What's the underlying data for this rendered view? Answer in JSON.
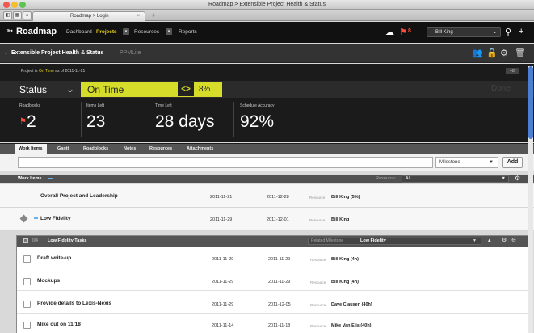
{
  "window": {
    "title": "Roadmap > Extensible Project Health & Status",
    "tab_title": "Roadmap > Login"
  },
  "navbar": {
    "brand": "Roadmap",
    "items": [
      {
        "label": "Dashboard"
      },
      {
        "label": "Projects"
      },
      {
        "label": "Resources"
      },
      {
        "label": "Reports"
      }
    ],
    "flag_count": "8",
    "user": "Bill King"
  },
  "project": {
    "title": "Extensible Project Health & Status",
    "subtitle": "PPMLite",
    "status_note_prefix": "Project is",
    "status_note_state": "On Time",
    "status_note_suffix": "as of 2011-11-21",
    "badge": "+8",
    "status_label": "Status",
    "status_value": "On Time",
    "percent": "8%",
    "done_label": "Done"
  },
  "metrics": [
    {
      "label": "Roadblocks",
      "value": "2"
    },
    {
      "label": "Items Left",
      "value": "23"
    },
    {
      "label": "Time Left",
      "value": "28 days"
    },
    {
      "label": "Schedule Accuracy",
      "value": "92%"
    }
  ],
  "subtabs": [
    "Work Items",
    "Gantt",
    "Roadblocks",
    "Notes",
    "Resources",
    "Attachments"
  ],
  "search": {
    "milestone_value": "Milestone",
    "add_label": "Add"
  },
  "work_items_header": {
    "title": "Work Items",
    "resource_label": "Resource:",
    "resource_value": "All"
  },
  "rows": [
    {
      "name": "Overall Project and Leadership",
      "start": "2011-11-21",
      "end": "2011-12-28",
      "resource_label": "Resource",
      "resource": "Bill King (5%)"
    },
    {
      "name": "Low Fidelity",
      "start": "2011-11-29",
      "end": "2011-12-01",
      "resource_label": "Resource",
      "resource": "Bill King"
    }
  ],
  "task_panel": {
    "count": "0/4",
    "title": "Low Fidelity Tasks",
    "related_label": "Related Milestone",
    "related_value": "Low Fidelity",
    "tasks": [
      {
        "name": "Draft write-up",
        "start": "2011-11-29",
        "end": "2011-11-29",
        "resource_label": "Resource",
        "resource": "Bill King (4h)"
      },
      {
        "name": "Mockups",
        "start": "2011-11-29",
        "end": "2011-11-29",
        "resource_label": "Resource",
        "resource": "Bill King (4h)"
      },
      {
        "name": "Provide details to Lexis-Nexis",
        "start": "2011-11-29",
        "end": "2011-12-05",
        "resource_label": "Resource",
        "resource": "Dave Clausen (40h)"
      },
      {
        "name": "Mike out on 11/18",
        "start": "2011-11-14",
        "end": "2011-11-18",
        "resource_label": "Resource",
        "resource": "Mike Van Elis (40h)"
      }
    ]
  },
  "colors": {
    "accent_yellow": "#d5dd2a",
    "nav_active": "#e6d317",
    "roadblock_red": "#ff4d3d",
    "link_blue": "#6ab0e6"
  }
}
